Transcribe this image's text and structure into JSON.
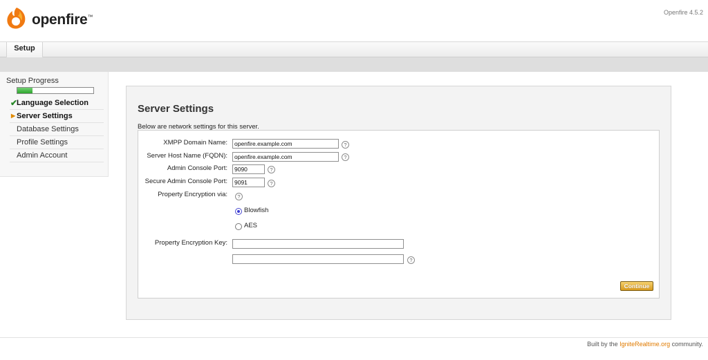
{
  "header": {
    "brand": "openfire",
    "trademark": "™",
    "version": "Openfire 4.5.2"
  },
  "tabs": [
    {
      "label": "Setup"
    }
  ],
  "sidebar": {
    "title": "Setup Progress",
    "progress_fraction": 0.2,
    "steps": [
      {
        "label": "Language Selection",
        "status": "done",
        "icon": "check-icon"
      },
      {
        "label": "Server Settings",
        "status": "current",
        "icon": "arrow-icon"
      },
      {
        "label": "Database Settings",
        "status": "pending"
      },
      {
        "label": "Profile Settings",
        "status": "pending"
      },
      {
        "label": "Admin Account",
        "status": "pending"
      }
    ]
  },
  "main": {
    "title": "Server Settings",
    "description": "Below are network settings for this server.",
    "fields": {
      "domain": {
        "label": "XMPP Domain Name:",
        "value": "openfire.example.com"
      },
      "host": {
        "label": "Server Host Name (FQDN):",
        "value": "openfire.example.com"
      },
      "admin_port": {
        "label": "Admin Console Port:",
        "value": "9090"
      },
      "secure_port": {
        "label": "Secure Admin Console Port:",
        "value": "9091"
      },
      "encryption": {
        "label": "Property Encryption via:",
        "options": [
          {
            "label": "Blowfish",
            "selected": true
          },
          {
            "label": "AES",
            "selected": false
          }
        ]
      },
      "encryption_key": {
        "label": "Property Encryption Key:",
        "value": "",
        "confirm_value": ""
      }
    },
    "help_glyph": "?",
    "continue_label": "Continue"
  },
  "footer": {
    "prefix": "Built by the ",
    "link": "IgniteRealtime.org",
    "suffix": " community."
  },
  "colors": {
    "accent": "#e07b00",
    "progress": "#3cb43c",
    "button": "#e0a52a"
  }
}
